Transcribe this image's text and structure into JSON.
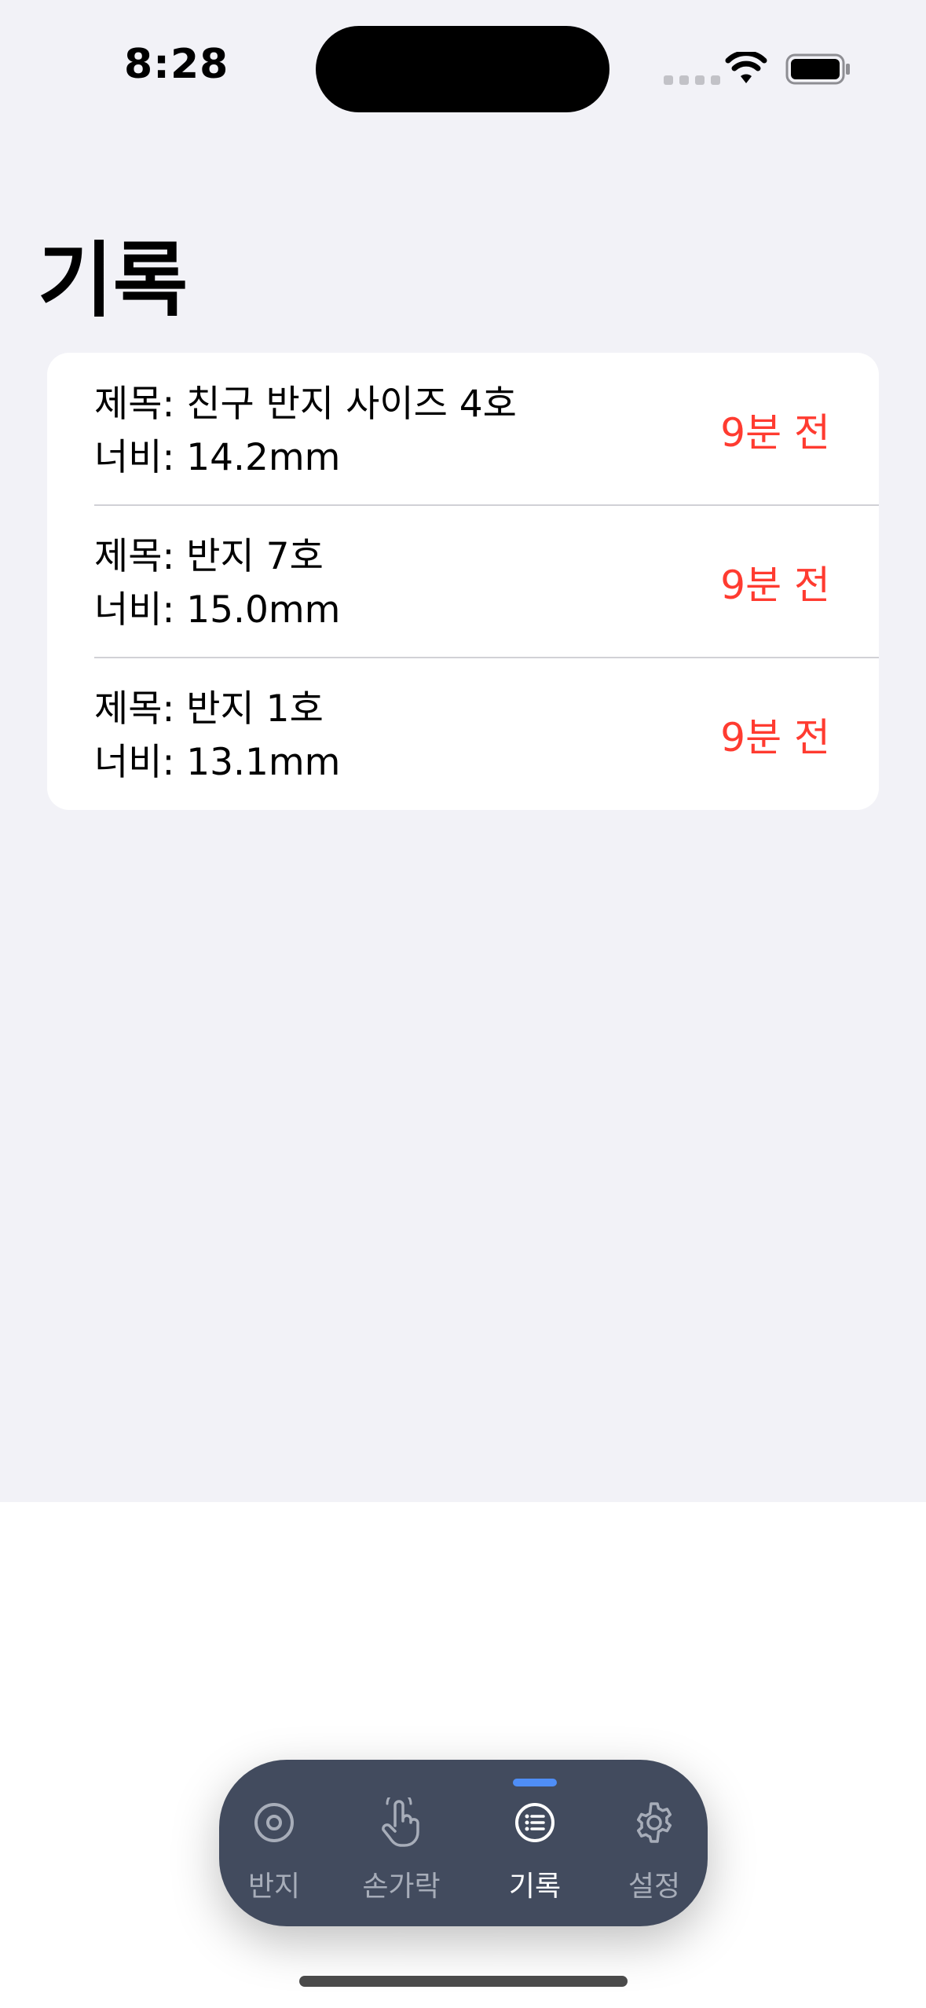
{
  "status_bar": {
    "time": "8:28"
  },
  "page": {
    "title": "기록"
  },
  "records": [
    {
      "title_line": "제목: 친구 반지 사이즈 4호",
      "width_line": "너비: 14.2mm",
      "time_ago": "9분 전"
    },
    {
      "title_line": "제목: 반지 7호",
      "width_line": "너비: 15.0mm",
      "time_ago": "9분 전"
    },
    {
      "title_line": "제목: 반지 1호",
      "width_line": "너비: 13.1mm",
      "time_ago": "9분 전"
    }
  ],
  "tab_bar": {
    "items": [
      {
        "label": "반지",
        "icon": "ring-icon"
      },
      {
        "label": "손가락",
        "icon": "hand-pointer-icon"
      },
      {
        "label": "기록",
        "icon": "list-icon"
      },
      {
        "label": "설정",
        "icon": "gear-icon"
      }
    ],
    "active": "기록"
  },
  "colors": {
    "background": "#f2f2f7",
    "card": "#ffffff",
    "accent_red": "#ff3b30",
    "tab_bar": "#424b5e",
    "tab_indicator": "#4f8ef7"
  }
}
